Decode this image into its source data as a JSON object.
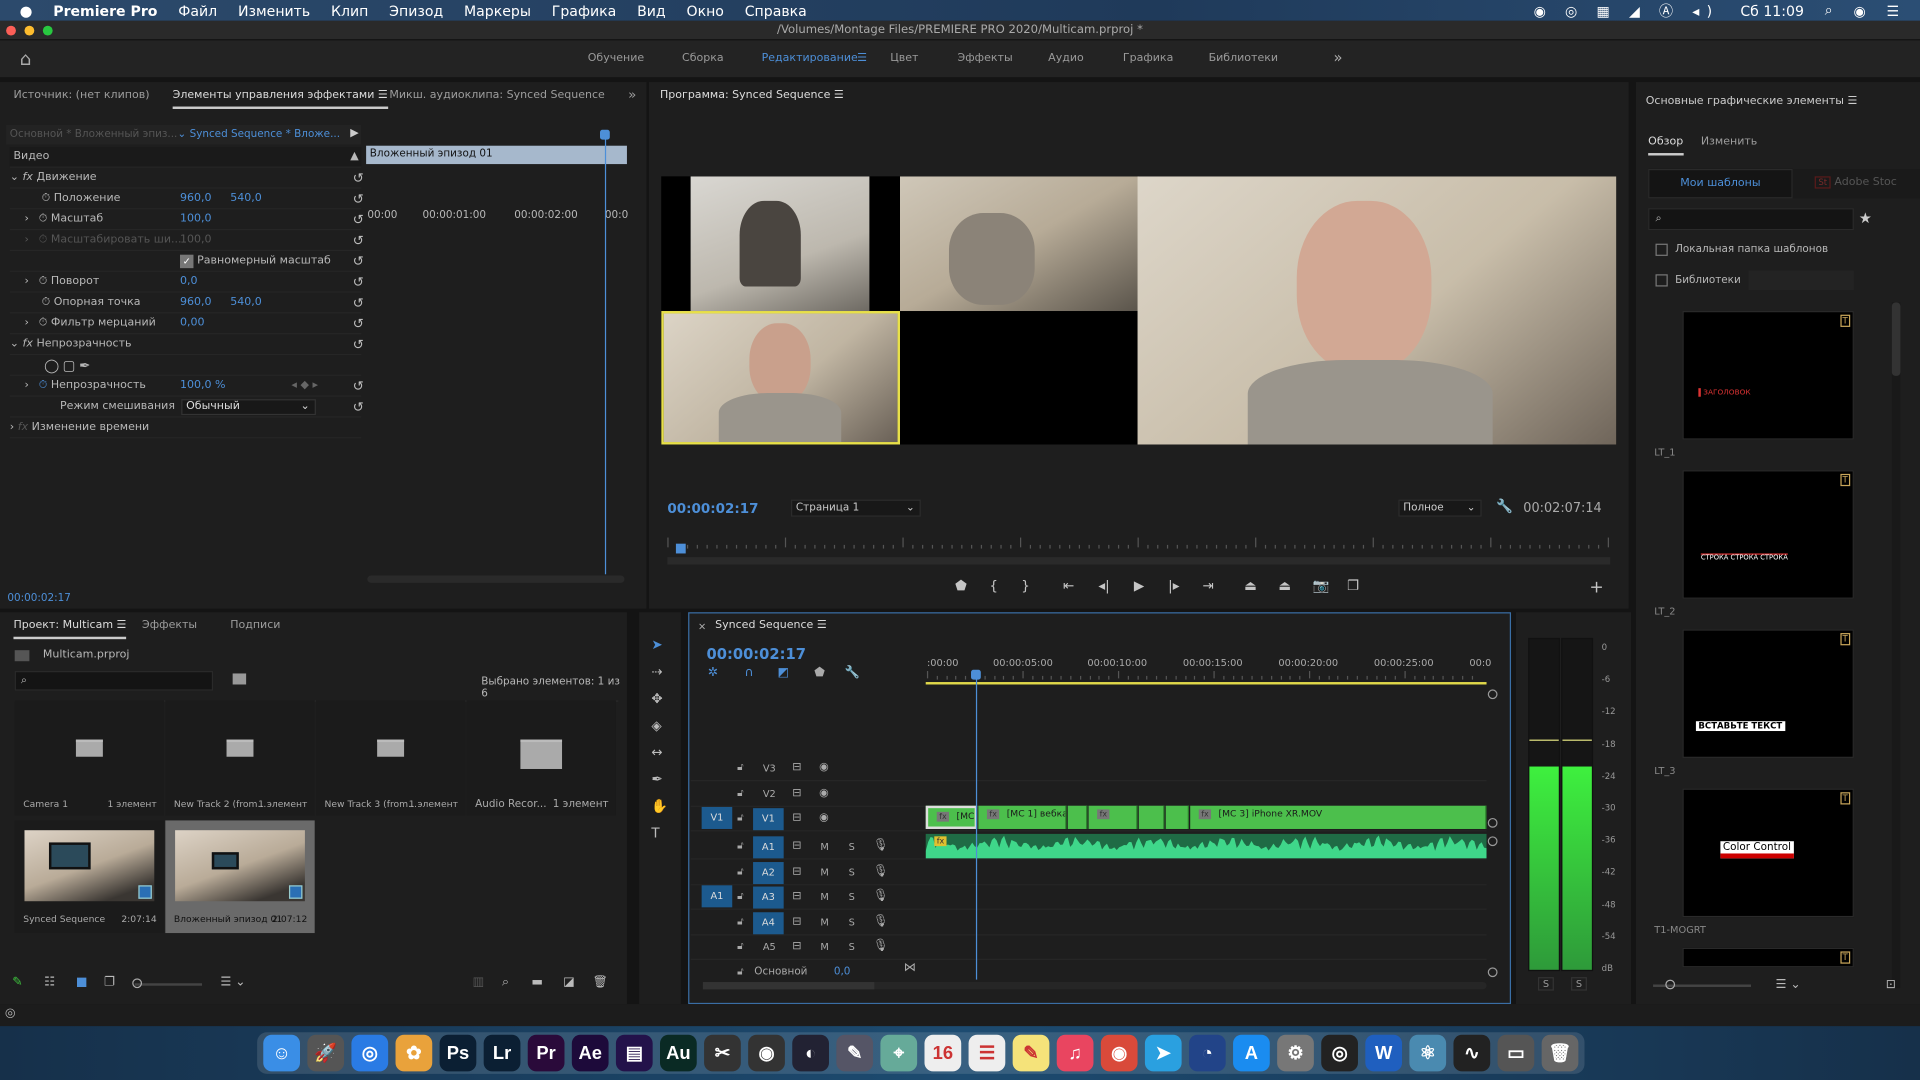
{
  "menubar": {
    "app": "Premiere Pro",
    "items": [
      "Файл",
      "Изменить",
      "Клип",
      "Эпизод",
      "Маркеры",
      "Графика",
      "Вид",
      "Окно",
      "Справка"
    ],
    "clock": "Сб 11:09"
  },
  "window": {
    "title": "/Volumes/Montage Files/PREMIERE PRO 2020/Multicam.prproj *"
  },
  "workspaces": {
    "tabs": [
      "Обучение",
      "Сборка",
      "Редактирование",
      "Цвет",
      "Эффекты",
      "Аудио",
      "Графика",
      "Библиотеки"
    ],
    "active": "Редактирование",
    "more": "»"
  },
  "effects_panel": {
    "tabs": [
      "Источник: (нет клипов)",
      "Элементы управления эффектами",
      "Микш. аудиоклипа: Synced Sequence"
    ],
    "master": "Основной * Вложенный эпиз...",
    "sequence": "Synced Sequence * Вложе...",
    "ruler": [
      "00:00",
      "00:00:01:00",
      "00:00:02:00",
      "00:0"
    ],
    "clip": "Вложенный эпизод 01",
    "section": "Видео",
    "motion": "Движение",
    "position": {
      "label": "Положение",
      "x": "960,0",
      "y": "540,0"
    },
    "scale": {
      "label": "Масштаб",
      "value": "100,0"
    },
    "scale_width": {
      "label": "Масштабировать ши...",
      "value": "100,0"
    },
    "uniform": {
      "label": "Равномерный масштаб",
      "checked": true
    },
    "rotation": {
      "label": "Поворот",
      "value": "0,0"
    },
    "anchor": {
      "label": "Опорная точка",
      "x": "960,0",
      "y": "540,0"
    },
    "flicker": {
      "label": "Фильтр мерцаний",
      "value": "0,00"
    },
    "opacity_section": "Непрозрачность",
    "opacity": {
      "label": "Непрозрачность",
      "value": "100,0 %"
    },
    "blend": {
      "label": "Режим смешивания",
      "value": "Обычный"
    },
    "time_remap": "Изменение времени",
    "timecode": "00:00:02:17"
  },
  "program": {
    "title": "Программа: Synced Sequence",
    "timecode": "00:00:02:17",
    "page": "Страница 1",
    "quality": "Полное",
    "duration": "00:02:07:14",
    "accent": "#e8e04a"
  },
  "project": {
    "tabs": [
      "Проект: Multicam",
      "Эффекты",
      "Подписи"
    ],
    "file": "Multicam.prproj",
    "selected": "Выбрано элементов: 1 из 6",
    "bins": [
      {
        "name": "Camera 1",
        "meta": "1 элемент"
      },
      {
        "name": "New Track 2 (from...",
        "meta": "1 элемент"
      },
      {
        "name": "New Track 3 (from...",
        "meta": "1 элемент"
      },
      {
        "name": "Audio Recor...",
        "meta": "1 элемент"
      }
    ],
    "sequences": [
      {
        "name": "Synced Sequence",
        "meta": "2:07:14"
      },
      {
        "name": "Вложенный эпизод 01",
        "meta": "2:07:12",
        "selected": true
      }
    ]
  },
  "timeline": {
    "title": "Synced Sequence",
    "timecode": "00:00:02:17",
    "ruler": [
      ":00:00",
      "00:00:05:00",
      "00:00:10:00",
      "00:00:15:00",
      "00:00:20:00",
      "00:00:25:00",
      "00:0"
    ],
    "video_tracks": [
      "V3",
      "V2",
      "V1"
    ],
    "audio_tracks": [
      "A1",
      "A2",
      "A3",
      "A4",
      "A5"
    ],
    "source_v": "V1",
    "source_a": "A1",
    "m": "M",
    "s": "S",
    "master": {
      "label": "Основной",
      "value": "0,0"
    },
    "clips": [
      "[MC",
      "[MC 1] вебка.",
      "[MC 3] iPhone XR.MOV"
    ],
    "clip_color": "#4cbf4c",
    "audio_color": "#3fd78a"
  },
  "meter": {
    "scale": [
      "0",
      "-6",
      "-12",
      "-18",
      "-24",
      "-30",
      "-36",
      "-42",
      "-48",
      "-54",
      "dB"
    ],
    "solo": [
      "S",
      "S"
    ],
    "peak_db": -17,
    "level_db": -22
  },
  "graphics": {
    "title": "Основные графические элементы",
    "tabs": [
      "Обзор",
      "Изменить"
    ],
    "sources": [
      "Мои шаблоны",
      "Adobe Stoc"
    ],
    "local": "Локальная папка шаблонов",
    "libraries": "Библиотеки",
    "templates": [
      {
        "name": "LT_1",
        "text": "ЗАГОЛОВОК"
      },
      {
        "name": "LT_2",
        "text": "СТРОКА СТРОКА СТРОКА"
      },
      {
        "name": "LT_3",
        "text": "ВСТАВЬТЕ ТЕКСТ"
      },
      {
        "name": "T1-MOGRT",
        "text": "Color Control"
      }
    ]
  },
  "dock": [
    {
      "n": "finder",
      "l": "☺",
      "c": "#3a8ee6"
    },
    {
      "n": "launchpad",
      "l": "🚀",
      "c": "#555"
    },
    {
      "n": "safari",
      "l": "◎",
      "c": "#2a7be4"
    },
    {
      "n": "photos",
      "l": "✿",
      "c": "#e9a23b"
    },
    {
      "n": "photoshop",
      "l": "Ps",
      "c": "#0b1f33"
    },
    {
      "n": "lightroom",
      "l": "Lr",
      "c": "#0b1f33"
    },
    {
      "n": "premiere",
      "l": "Pr",
      "c": "#2a0a3a"
    },
    {
      "n": "after-effects",
      "l": "Ae",
      "c": "#1d0a3a"
    },
    {
      "n": "media-encoder",
      "l": "▤",
      "c": "#23124a"
    },
    {
      "n": "audition",
      "l": "Au",
      "c": "#0a2a24"
    },
    {
      "n": "final-cut",
      "l": "✂",
      "c": "#333"
    },
    {
      "n": "davinci",
      "l": "◉",
      "c": "#333"
    },
    {
      "n": "motion",
      "l": "◐",
      "c": "#223"
    },
    {
      "n": "preview",
      "l": "✎",
      "c": "#556"
    },
    {
      "n": "maps",
      "l": "⌖",
      "c": "#6a9"
    },
    {
      "n": "calendar",
      "l": "16",
      "c": "#eee"
    },
    {
      "n": "reminders",
      "l": "☰",
      "c": "#eee"
    },
    {
      "n": "notes",
      "l": "✎",
      "c": "#f5e37a"
    },
    {
      "n": "music",
      "l": "♫",
      "c": "#e94560"
    },
    {
      "n": "chrome",
      "l": "◉",
      "c": "#d94a3a"
    },
    {
      "n": "telegram",
      "l": "➤",
      "c": "#2aa0e0"
    },
    {
      "n": "spotlight-app",
      "l": "◔",
      "c": "#248"
    },
    {
      "n": "app-store",
      "l": "A",
      "c": "#1a8cf0"
    },
    {
      "n": "system-preferences",
      "l": "⚙",
      "c": "#777"
    },
    {
      "n": "obs",
      "l": "◎",
      "c": "#222"
    },
    {
      "n": "word",
      "l": "W",
      "c": "#1f5fbf"
    },
    {
      "n": "atom",
      "l": "⚛",
      "c": "#4a8ab0"
    },
    {
      "n": "activity-monitor",
      "l": "∿",
      "c": "#222"
    },
    {
      "n": "folder",
      "l": "▭",
      "c": "#555"
    },
    {
      "n": "trash",
      "l": "🗑",
      "c": "#666"
    }
  ]
}
